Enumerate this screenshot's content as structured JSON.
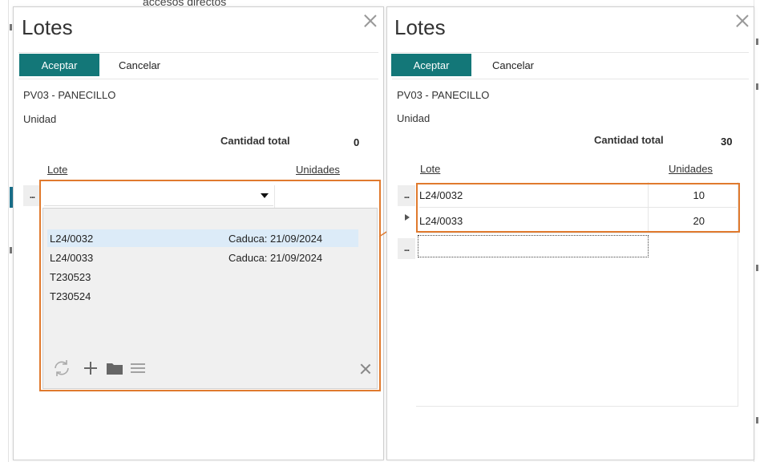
{
  "background": {
    "top_text": "accesos directos"
  },
  "colors": {
    "accent": "#137778",
    "highlight": "#e07a2e",
    "selected_row": "#dcebf8"
  },
  "left_dialog": {
    "title": "Lotes",
    "accept_label": "Aceptar",
    "cancel_label": "Cancelar",
    "product": "PV03 - PANECILLO",
    "unit_label": "Unidad",
    "total_label": "Cantidad total",
    "total_value": "0",
    "columns": {
      "lot": "Lote",
      "units": "Unidades"
    },
    "row_menu": "...",
    "dropdown": {
      "items": [
        {
          "code": "L24/0032",
          "expiry": "Caduca: 21/09/2024",
          "selected": true
        },
        {
          "code": "L24/0033",
          "expiry": "Caduca: 21/09/2024",
          "selected": false
        },
        {
          "code": "T230523",
          "expiry": "",
          "selected": false
        },
        {
          "code": "T230524",
          "expiry": "",
          "selected": false
        }
      ],
      "icons": [
        "refresh-icon",
        "add-icon",
        "folder-icon",
        "list-icon",
        "close-icon"
      ]
    }
  },
  "right_dialog": {
    "title": "Lotes",
    "accept_label": "Aceptar",
    "cancel_label": "Cancelar",
    "product": "PV03 - PANECILLO",
    "unit_label": "Unidad",
    "total_label": "Cantidad total",
    "total_value": "30",
    "columns": {
      "lot": "Lote",
      "units": "Unidades"
    },
    "row_menu": "...",
    "rows": [
      {
        "lot": "L24/0032",
        "units": "10"
      },
      {
        "lot": "L24/0033",
        "units": "20"
      }
    ]
  }
}
